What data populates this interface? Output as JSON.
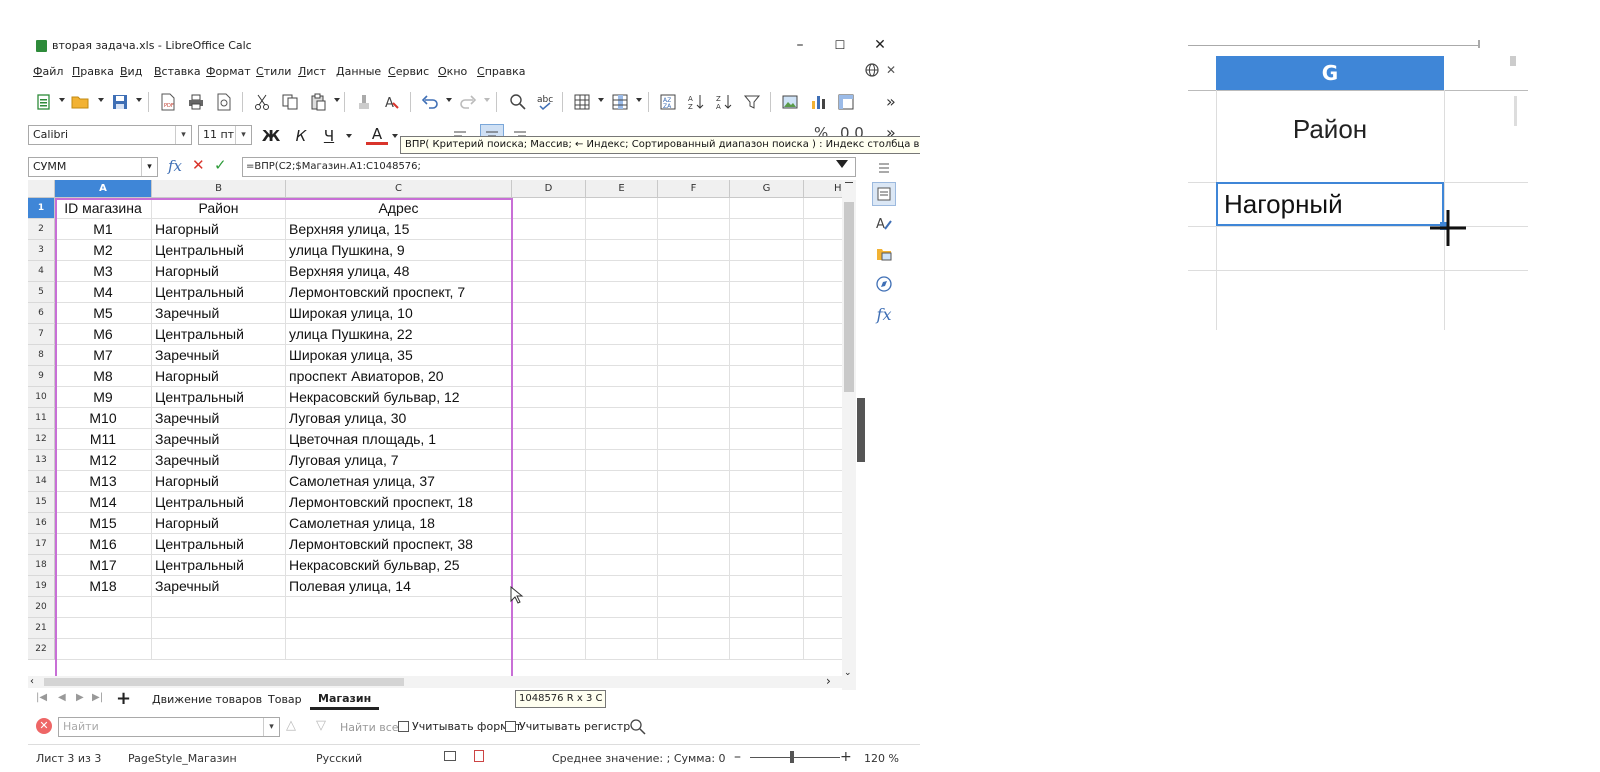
{
  "window": {
    "title": "вторая задача.xls - LibreOffice Calc",
    "minimize": "–",
    "maximize": "☐",
    "close": "✕"
  },
  "menu": [
    "Файл",
    "Правка",
    "Вид",
    "Вставка",
    "Формат",
    "Стили",
    "Лист",
    "Данные",
    "Сервис",
    "Окно",
    "Справка"
  ],
  "toolbar": {
    "more": "»",
    "font_name": "Calibri",
    "font_size": "11 пт",
    "bold": "Ж",
    "italic": "К",
    "underline": "Ч",
    "font_color": "А",
    "percent": "%",
    "decimal": "0.0"
  },
  "tooltip": "ВПР( Критерий поиска; Массив; ← Индекс; Сортированный диапазон поиска ) : Индекс столбца в мас",
  "formula_bar": {
    "name_box": "СУММ",
    "fx": "fx",
    "cancel": "✕",
    "accept": "✓",
    "formula": "=ВПР(C2;$Магазин.A1:C1048576;"
  },
  "columns": [
    "A",
    "B",
    "C",
    "D",
    "E",
    "F",
    "G",
    "H"
  ],
  "rows": [
    "1",
    "2",
    "3",
    "4",
    "5",
    "6",
    "7",
    "8",
    "9",
    "10",
    "11",
    "12",
    "13",
    "14",
    "15",
    "16",
    "17",
    "18",
    "19",
    "20",
    "21",
    "22"
  ],
  "table": {
    "headers": [
      "ID магазина",
      "Район",
      "Адрес"
    ],
    "data": [
      [
        "M1",
        "Нагорный",
        "Верхняя улица, 15"
      ],
      [
        "M2",
        "Центральный",
        "улица Пушкина, 9"
      ],
      [
        "M3",
        "Нагорный",
        "Верхняя улица, 48"
      ],
      [
        "M4",
        "Центральный",
        "Лермонтовский проспект, 7"
      ],
      [
        "M5",
        "Заречный",
        "Широкая улица, 10"
      ],
      [
        "M6",
        "Центральный",
        "улица Пушкина, 22"
      ],
      [
        "M7",
        "Заречный",
        "Широкая улица, 35"
      ],
      [
        "M8",
        "Нагорный",
        "проспект Авиаторов, 20"
      ],
      [
        "M9",
        "Центральный",
        "Некрасовский бульвар, 12"
      ],
      [
        "M10",
        "Заречный",
        "Луговая улица, 30"
      ],
      [
        "M11",
        "Заречный",
        "Цветочная площадь, 1"
      ],
      [
        "M12",
        "Заречный",
        "Луговая улица, 7"
      ],
      [
        "M13",
        "Нагорный",
        "Самолетная улица, 37"
      ],
      [
        "M14",
        "Центральный",
        "Лермонтовский проспект, 18"
      ],
      [
        "M15",
        "Нагорный",
        "Самолетная улица, 18"
      ],
      [
        "M16",
        "Центральный",
        "Лермонтовский проспект, 38"
      ],
      [
        "M17",
        "Центральный",
        "Некрасовский бульвар, 25"
      ],
      [
        "M18",
        "Заречный",
        "Полевая улица, 14"
      ]
    ]
  },
  "range_tip": "1048576 R  x 3 C",
  "sheets": {
    "tabs": [
      "Движение товаров",
      "Товар",
      "Магазин"
    ],
    "active": "Магазин",
    "add": "+"
  },
  "find": {
    "placeholder": "Найти",
    "find_all": "Найти все",
    "match_format": "Учитывать формат",
    "match_case": "Учитывать регистр"
  },
  "status": {
    "sheet": "Лист 3 из 3",
    "page_style": "PageStyle_Магазин",
    "language": "Русский",
    "summary": "Среднее значение: ; Сумма: 0",
    "zoom_minus": "–",
    "zoom_plus": "+",
    "zoom": "120 %"
  },
  "zoom_panel": {
    "column": "G",
    "header": "Район",
    "value": "Нагорный"
  },
  "colors": {
    "accent": "#3f86d7",
    "selection_border": "#c86fd6",
    "cancel_red": "#d9342b",
    "accept_green": "#2e9b3a"
  }
}
